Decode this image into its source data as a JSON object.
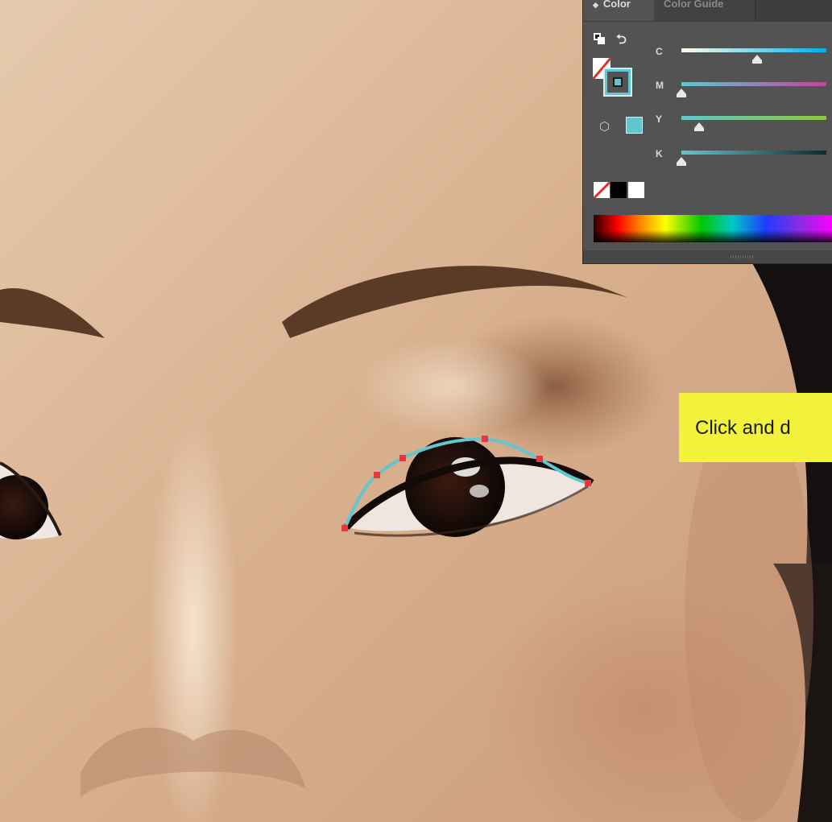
{
  "color_panel": {
    "tabs": [
      {
        "label": "Color",
        "active": true
      },
      {
        "label": "Color Guide",
        "active": false
      }
    ],
    "active_color": "#62c6cf",
    "sliders": [
      {
        "label": "C",
        "value_fraction": 0.52,
        "gradient": [
          "#fffde6",
          "#00aeef"
        ]
      },
      {
        "label": "M",
        "value_fraction": 0.0,
        "gradient": [
          "#62c6cf",
          "#c2449b"
        ]
      },
      {
        "label": "Y",
        "value_fraction": 0.12,
        "gradient": [
          "#62c6cf",
          "#8dc63f"
        ]
      },
      {
        "label": "K",
        "value_fraction": 0.0,
        "gradient": [
          "#62c6cf",
          "#0f2a2c"
        ]
      }
    ],
    "quick_swatches": [
      "none",
      "#000000",
      "#ffffff"
    ],
    "icons": {
      "default_colors": "default-fill-stroke-icon",
      "swap": "swap-fill-stroke-icon",
      "fill": "fill-none-swatch",
      "stroke": "stroke-swatch",
      "out_of_gamut": "out-of-web-gamut-cube-icon"
    }
  },
  "callout": {
    "text": "Click and d"
  },
  "canvas": {
    "path_stroke_color": "#62c6cf",
    "anchor_color": "#e8383d"
  }
}
